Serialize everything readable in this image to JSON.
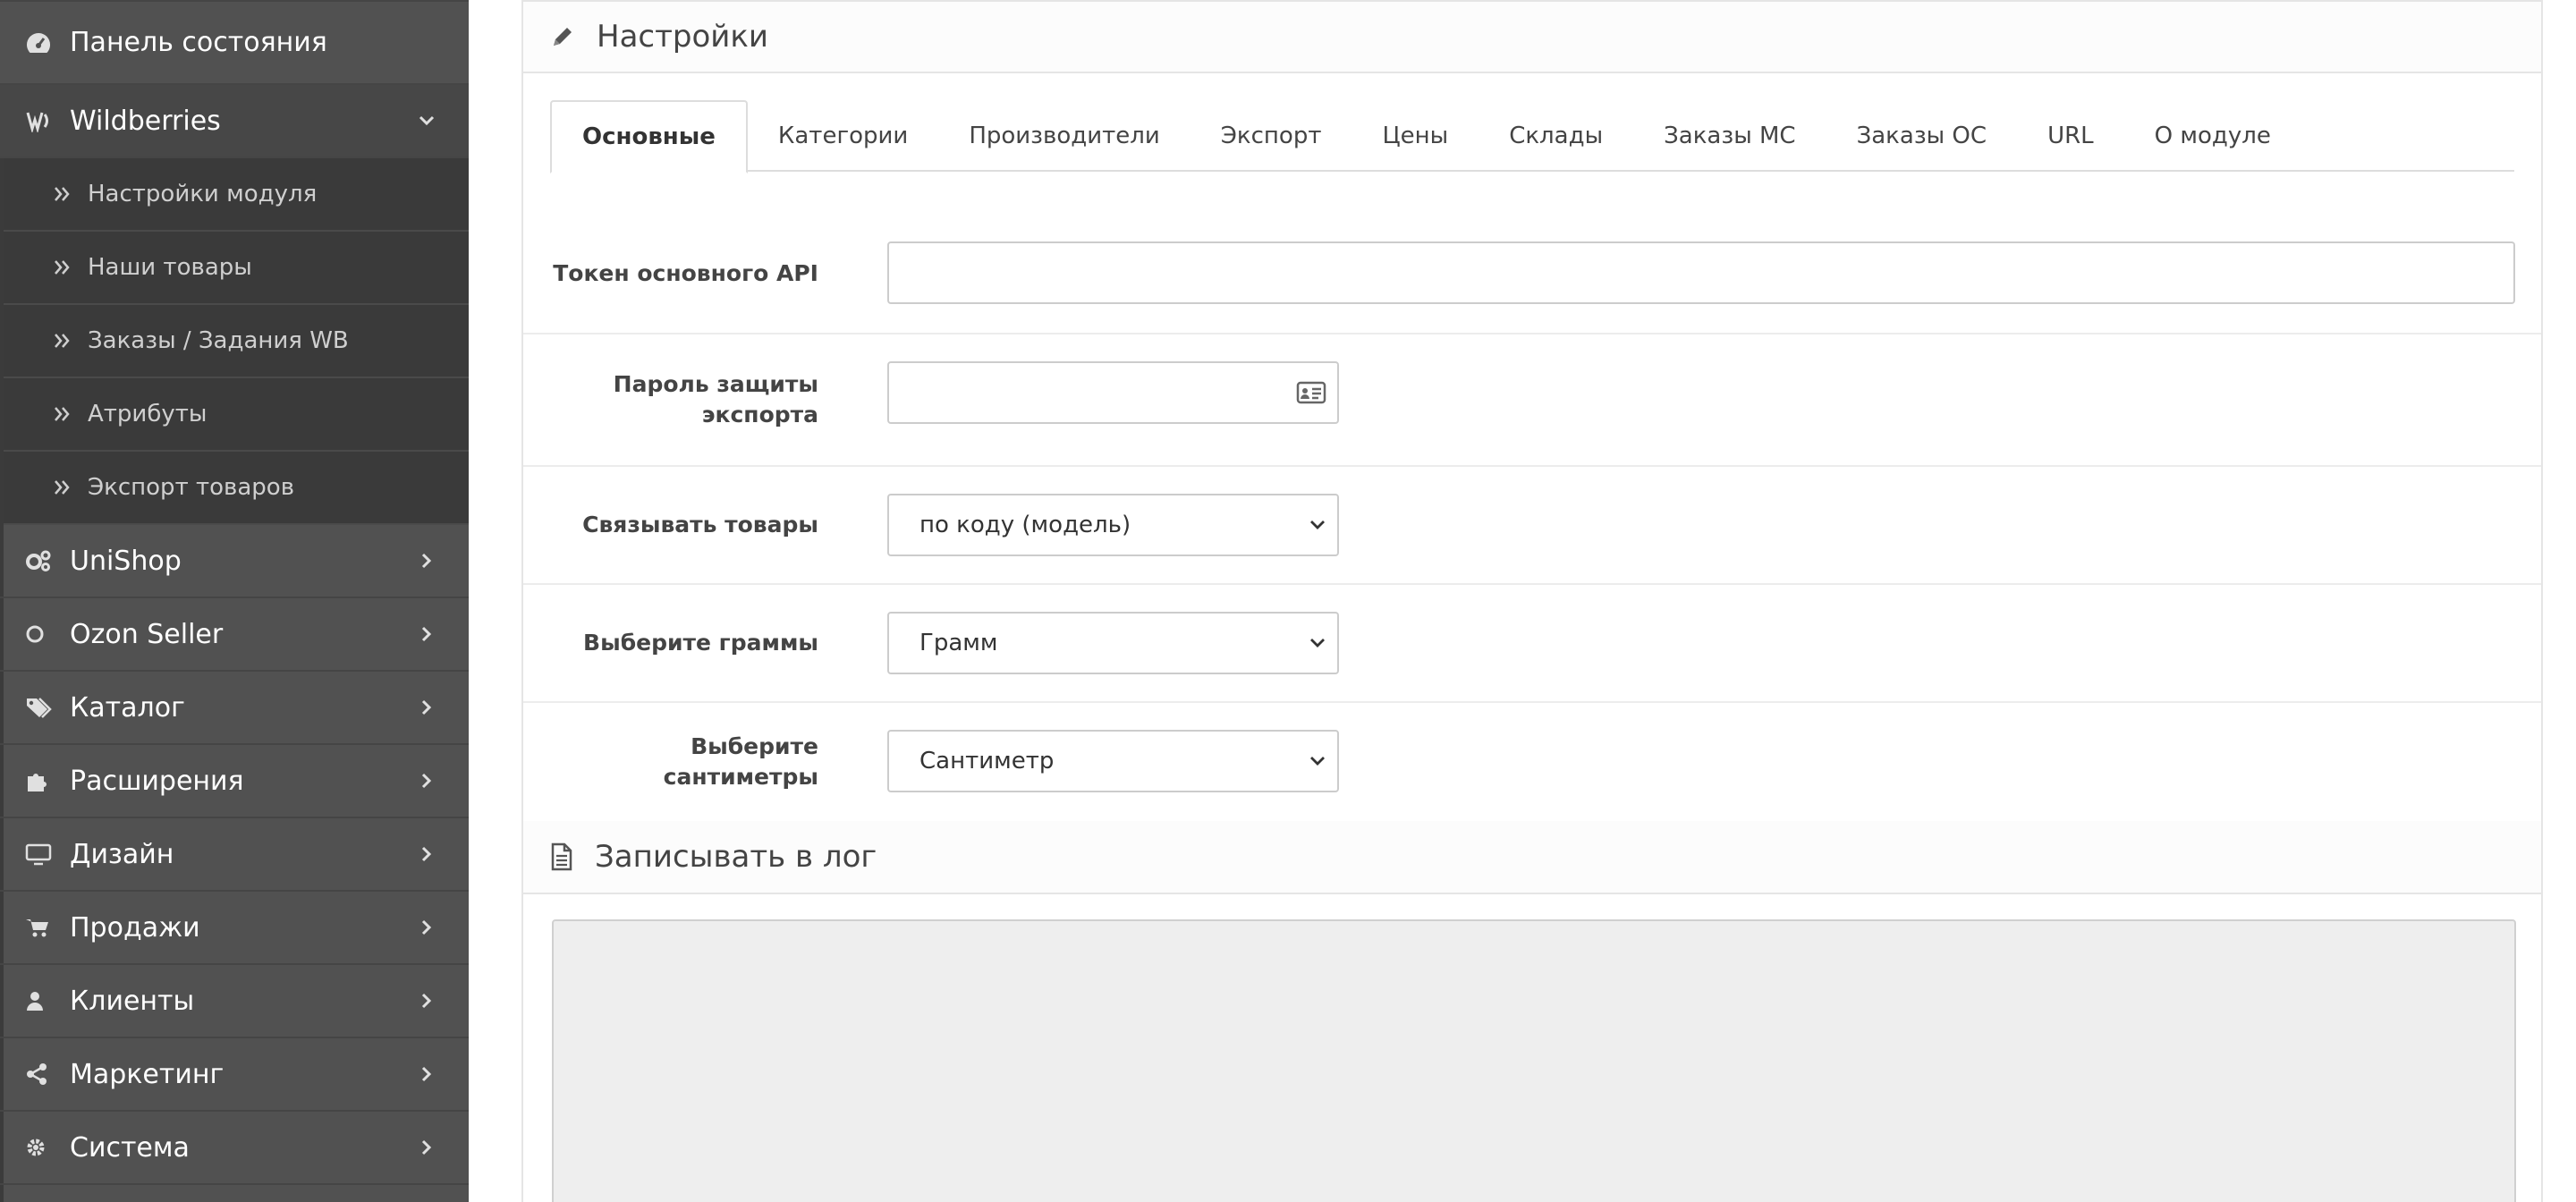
{
  "sidebar": {
    "dashboard": {
      "label": "Панель состояния",
      "icon": "dashboard-icon"
    },
    "wildberries": {
      "label": "Wildberries",
      "icon": "wildberries-icon",
      "items": [
        {
          "label": "Настройки модуля"
        },
        {
          "label": "Наши товары"
        },
        {
          "label": "Заказы / Задания WB"
        },
        {
          "label": "Атрибуты"
        },
        {
          "label": "Экспорт товаров"
        }
      ]
    },
    "menu": [
      {
        "label": "UniShop",
        "icon": "cogs-icon"
      },
      {
        "label": "Ozon Seller",
        "icon": "circle-icon"
      },
      {
        "label": "Каталог",
        "icon": "tags-icon"
      },
      {
        "label": "Расширения",
        "icon": "puzzle-icon"
      },
      {
        "label": "Дизайн",
        "icon": "monitor-icon"
      },
      {
        "label": "Продажи",
        "icon": "cart-icon"
      },
      {
        "label": "Клиенты",
        "icon": "user-icon"
      },
      {
        "label": "Маркетинг",
        "icon": "share-icon"
      },
      {
        "label": "Система",
        "icon": "gear-icon"
      }
    ]
  },
  "panel": {
    "title": "Настройки",
    "tabs": [
      {
        "label": "Основные",
        "active": true
      },
      {
        "label": "Категории"
      },
      {
        "label": "Производители"
      },
      {
        "label": "Экспорт"
      },
      {
        "label": "Цены"
      },
      {
        "label": "Склады"
      },
      {
        "label": "Заказы МС"
      },
      {
        "label": "Заказы ОС"
      },
      {
        "label": "URL"
      },
      {
        "label": "О модуле"
      }
    ],
    "fields": {
      "api_token": {
        "label": "Токен основного API",
        "value": ""
      },
      "export_password": {
        "label_line1": "Пароль защиты",
        "label_line2": "экспорта",
        "value": ""
      },
      "link_products": {
        "label": "Связывать товары",
        "value": "по коду (модель)"
      },
      "grams": {
        "label": "Выберите граммы",
        "value": "Грамм"
      },
      "centimeters": {
        "label": "Выберите сантиметры",
        "value": "Сантиметр"
      }
    },
    "log": {
      "title": "Записывать в лог",
      "content": ""
    }
  },
  "colors": {
    "sidebar_bg": "#515151",
    "submenu_bg": "#3a3a3a",
    "log_bg": "#eeeeee"
  }
}
